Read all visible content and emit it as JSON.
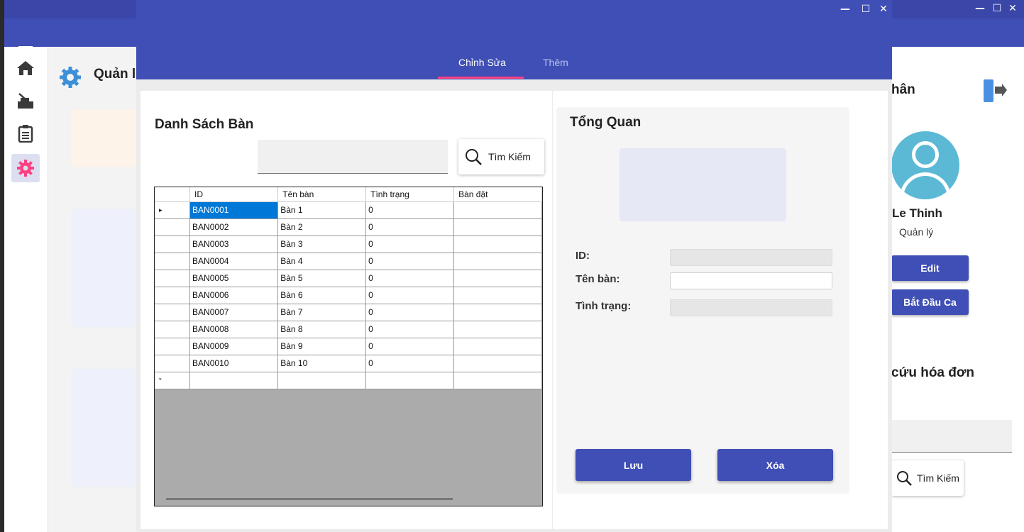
{
  "background": {
    "page_title": "Quản l",
    "window_controls": [
      "—",
      "☐",
      "✕"
    ],
    "sidebar_items": [
      {
        "name": "home-icon"
      },
      {
        "name": "kitchen-icon"
      },
      {
        "name": "clipboard-icon"
      },
      {
        "name": "settings-icon",
        "active": true
      }
    ],
    "right_panel": {
      "personal_title": "hân",
      "user_name": "Le Thinh",
      "user_role": "Quản lý",
      "edit_label": "Edit",
      "start_shift_label": "Bắt Đầu Ca",
      "invoice_title": "cứu hóa đơn",
      "search_label": "Tìm Kiếm"
    }
  },
  "dialog": {
    "window_controls": [
      "—",
      "☐",
      "✕"
    ],
    "tabs": [
      {
        "label": "Chỉnh Sửa",
        "active": true
      },
      {
        "label": "Thêm",
        "active": false
      }
    ],
    "list": {
      "title": "Danh Sách Bàn",
      "search_placeholder": "",
      "search_label": "Tìm Kiếm",
      "columns": [
        "ID",
        "Tên bàn",
        "Tình trạng",
        "Bàn đặt"
      ],
      "rows": [
        [
          "BAN0001",
          "Bàn 1",
          "0",
          ""
        ],
        [
          "BAN0002",
          "Bàn 2",
          "0",
          ""
        ],
        [
          "BAN0003",
          "Bàn 3",
          "0",
          ""
        ],
        [
          "BAN0004",
          "Bàn 4",
          "0",
          ""
        ],
        [
          "BAN0005",
          "Bàn 5",
          "0",
          ""
        ],
        [
          "BAN0006",
          "Bàn 6",
          "0",
          ""
        ],
        [
          "BAN0007",
          "Bàn 7",
          "0",
          ""
        ],
        [
          "BAN0008",
          "Bàn 8",
          "0",
          ""
        ],
        [
          "BAN0009",
          "Bàn 9",
          "0",
          ""
        ],
        [
          "BAN0010",
          "Bàn 10",
          "0",
          ""
        ]
      ],
      "current_row_marker": "▸",
      "new_row_marker": "*"
    },
    "overview": {
      "title": "Tổng Quan",
      "fields": [
        {
          "label": "ID:",
          "value": "",
          "readonly": true
        },
        {
          "label": "Tên bàn:",
          "value": "",
          "readonly": false
        },
        {
          "label": "Tình trạng:",
          "value": "",
          "readonly": true
        }
      ],
      "save_label": "Lưu",
      "delete_label": "Xóa"
    }
  },
  "colors": {
    "primary": "#3f4fb5",
    "tab_indicator": "#ff4081",
    "selection": "#0078d7",
    "settings_icon": "#ff4081",
    "avatar": "#5bb9d6"
  }
}
